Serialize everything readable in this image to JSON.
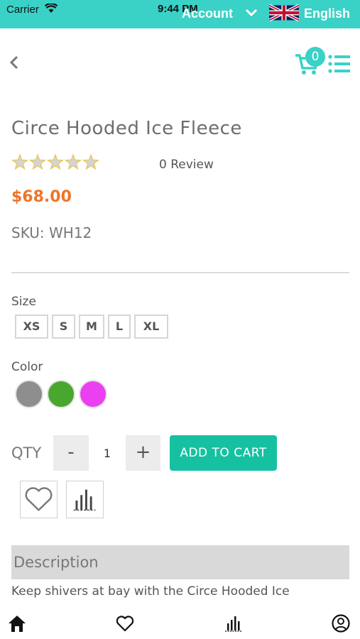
{
  "status_bar": {
    "carrier": "Carrier",
    "time": "9:44 PM"
  },
  "header": {
    "account_label": "Account",
    "language_label": "English"
  },
  "cart": {
    "count": "0"
  },
  "product": {
    "title": "Circe Hooded Ice Fleece",
    "rating": 0,
    "rating_max": 5,
    "review_text": "0 Review",
    "price": "$68.00",
    "sku": "SKU:  WH12"
  },
  "options": {
    "size_label": "Size",
    "sizes": [
      "XS",
      "S",
      "M",
      "L",
      "XL"
    ],
    "color_label": "Color",
    "colors": [
      "#8e8e8e",
      "#4aa72e",
      "#ea40f2"
    ]
  },
  "purchase": {
    "qty_label": "QTY",
    "qty_minus": "-",
    "qty_value": "1",
    "qty_plus": "+",
    "add_to_cart": "ADD TO CART"
  },
  "description": {
    "heading": "Description",
    "text": "Keep shivers at bay with the Circe Hooded Ice"
  },
  "icons": {
    "back": "chevron-left-icon",
    "cart": "cart-icon",
    "menu": "list-icon",
    "wishlist": "heart-icon",
    "compare": "bar-chart-icon",
    "tabs": [
      "home-icon",
      "heart-icon",
      "compare-icon",
      "user-icon"
    ]
  },
  "theme": {
    "accent": "#3ad1c6",
    "price": "#f07428",
    "button": "#16c1a1"
  }
}
